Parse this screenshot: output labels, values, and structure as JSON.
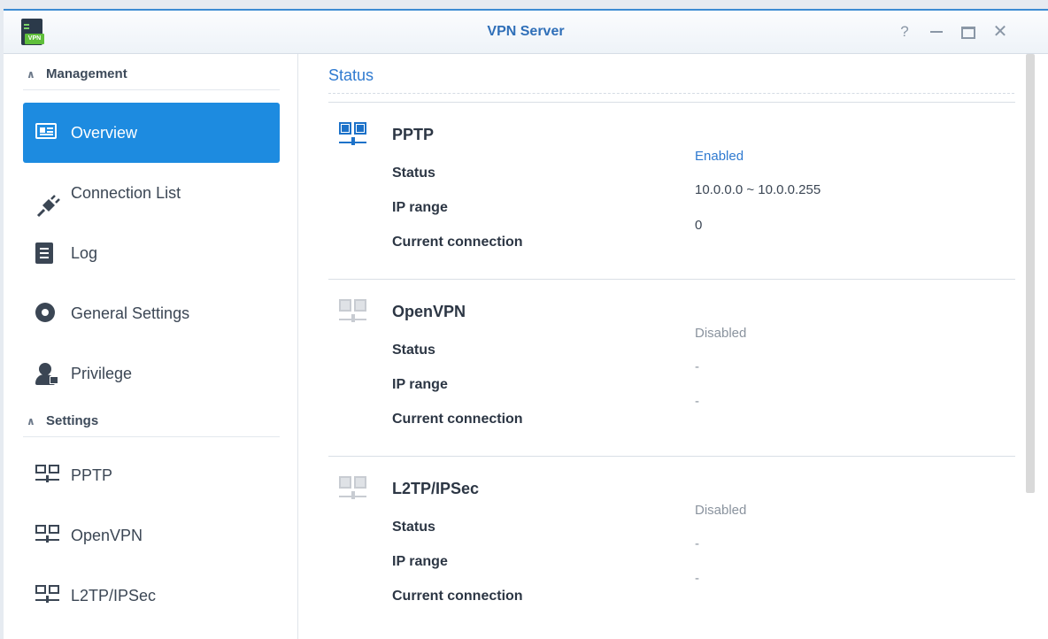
{
  "window": {
    "title": "VPN Server",
    "icon_tag": "VPN",
    "controls": {
      "help": "?",
      "close": "✕"
    }
  },
  "sidebar": {
    "management_header": "Management",
    "settings_header": "Settings",
    "management_items": [
      {
        "label": "Overview",
        "icon": "overview-icon",
        "active": true
      },
      {
        "label": "Connection List",
        "icon": "plug-icon"
      },
      {
        "label": "Log",
        "icon": "log-icon"
      },
      {
        "label": "General Settings",
        "icon": "gear-icon"
      },
      {
        "label": "Privilege",
        "icon": "user-lock-icon"
      }
    ],
    "settings_items": [
      {
        "label": "PPTP",
        "icon": "network-icon"
      },
      {
        "label": "OpenVPN",
        "icon": "network-icon"
      },
      {
        "label": "L2TP/IPSec",
        "icon": "network-icon"
      }
    ]
  },
  "main": {
    "section_title": "Status",
    "labels": {
      "status": "Status",
      "ip_range": "IP range",
      "current_connection": "Current connection"
    },
    "protocols": [
      {
        "name": "PPTP",
        "status": "Enabled",
        "ip_range": "10.0.0.0 ~ 10.0.0.255",
        "current_connection": "0",
        "enabled": true
      },
      {
        "name": "OpenVPN",
        "status": "Disabled",
        "ip_range": "-",
        "current_connection": "-",
        "enabled": false
      },
      {
        "name": "L2TP/IPSec",
        "status": "Disabled",
        "ip_range": "-",
        "current_connection": "-",
        "enabled": false
      }
    ]
  },
  "colors": {
    "accent": "#1d8be0",
    "title_blue": "#2f6fb8",
    "enabled_blue": "#2f7ad0",
    "disabled_grey": "#8a939e"
  }
}
